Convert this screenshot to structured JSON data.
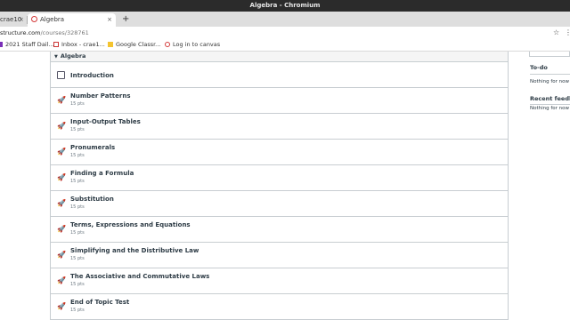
{
  "window": {
    "title": "Algebra - Chromium"
  },
  "tabs": [
    {
      "label": "crae10",
      "close": "×"
    },
    {
      "label": "Algebra",
      "close": "×"
    }
  ],
  "new_tab": "+",
  "address": {
    "host": "structure.com",
    "path": "/courses/328761"
  },
  "bookmarks": [
    {
      "label": "2021 Staff Dail..."
    },
    {
      "label": "Inbox - crae1..."
    },
    {
      "label": "Google Classr..."
    },
    {
      "label": "Log in to canvas"
    }
  ],
  "module": {
    "caret": "▼",
    "title": "Algebra",
    "items": [
      {
        "title": "Introduction",
        "points": "",
        "icon": "page-icon"
      },
      {
        "title": "Number Patterns",
        "points": "15 pts",
        "icon": "rocket-icon"
      },
      {
        "title": "Input-Output Tables",
        "points": "15 pts",
        "icon": "rocket-icon"
      },
      {
        "title": "Pronumerals",
        "points": "15 pts",
        "icon": "rocket-icon"
      },
      {
        "title": "Finding a Formula",
        "points": "15 pts",
        "icon": "rocket-icon"
      },
      {
        "title": "Substitution",
        "points": "15 pts",
        "icon": "rocket-icon"
      },
      {
        "title": "Terms, Expressions and Equations",
        "points": "15 pts",
        "icon": "rocket-icon"
      },
      {
        "title": "Simplifying and the Distributive Law",
        "points": "15 pts",
        "icon": "rocket-icon"
      },
      {
        "title": "The Associative and Commutative Laws",
        "points": "15 pts",
        "icon": "rocket-icon"
      },
      {
        "title": "End of Topic Test",
        "points": "15 pts",
        "icon": "rocket-icon"
      }
    ]
  },
  "sidebar": {
    "todo_heading": "To-do",
    "todo_text": "Nothing for now",
    "feedback_heading": "Recent feedback",
    "feedback_text": "Nothing for now"
  },
  "colors": {
    "titlebar": "#2b2b2b",
    "text": "#2d3b45",
    "border": "#c7cdd1"
  }
}
